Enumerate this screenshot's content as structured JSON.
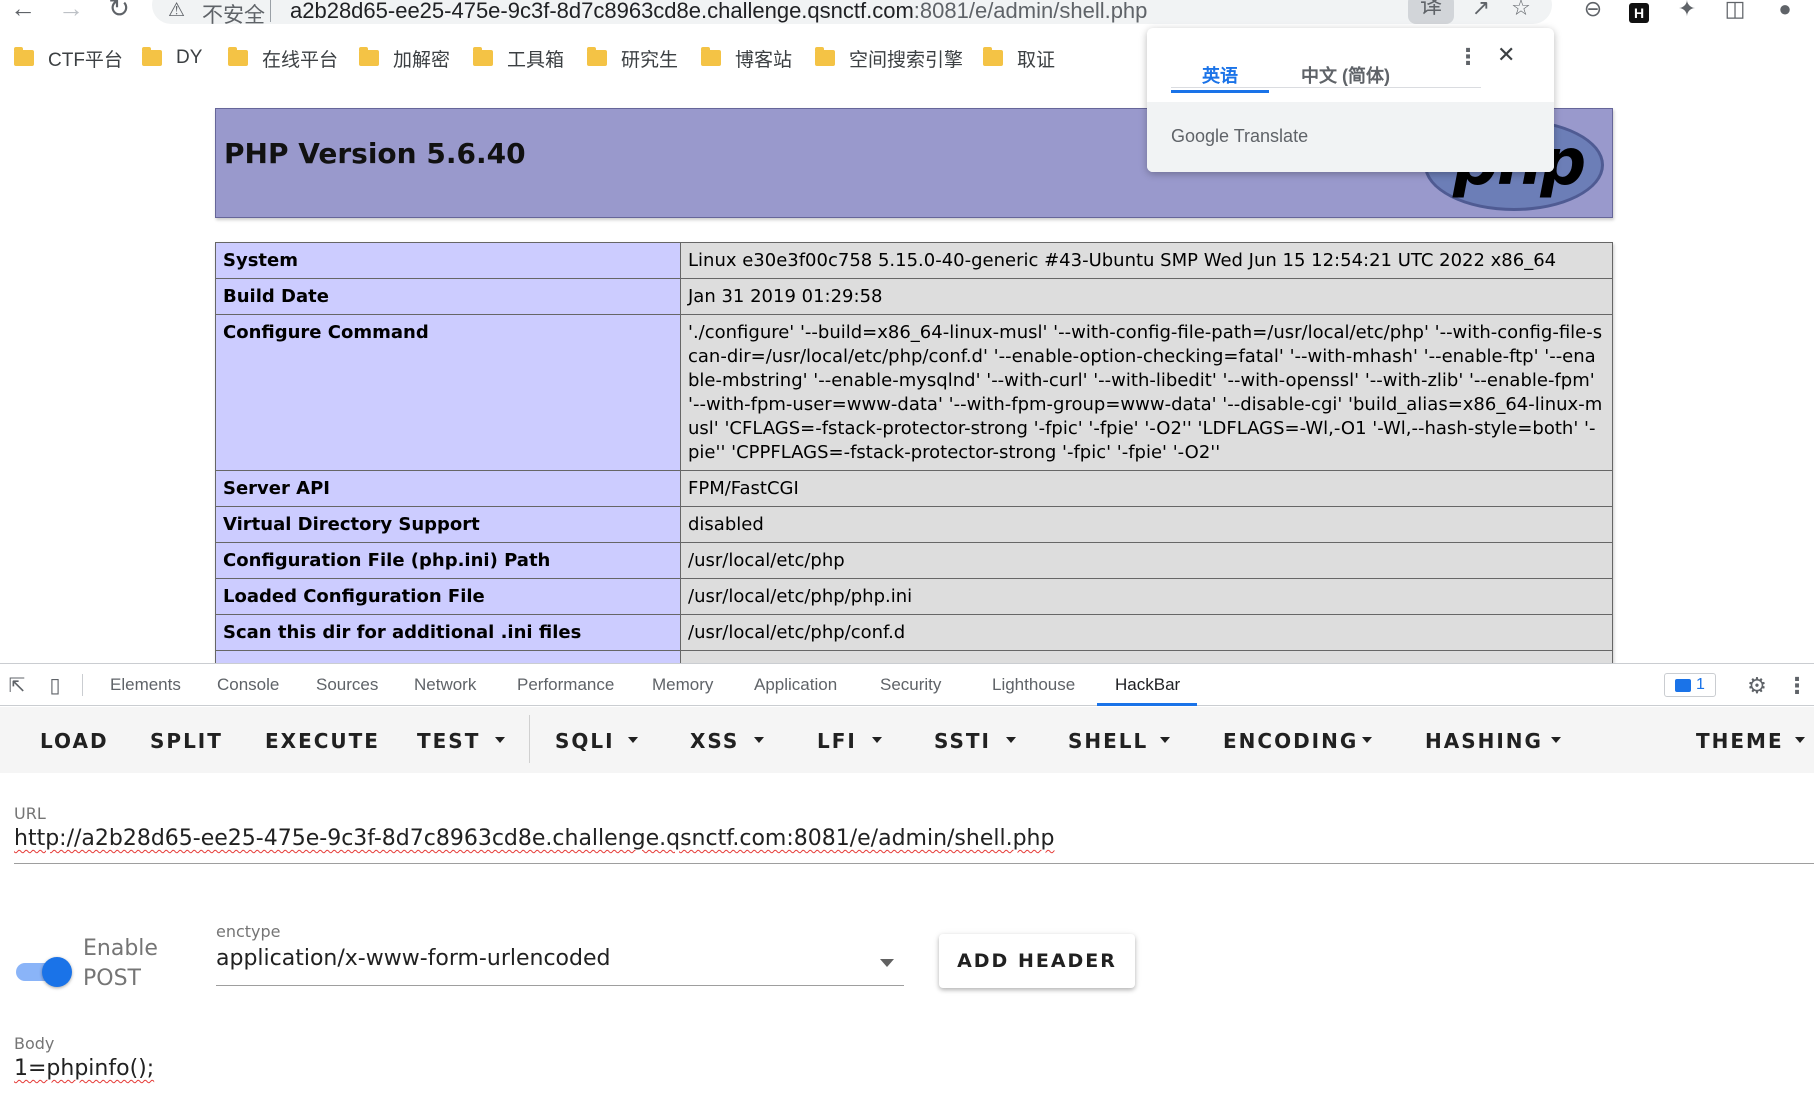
{
  "browser": {
    "address": {
      "security_label": "不安全",
      "host": "a2b28d65-ee25-475e-9c3f-8d7c8963cd8e.challenge.qsnctf.com",
      "rest": ":8081/e/admin/shell.php"
    },
    "bookmarks": [
      "CTF平台",
      "DY",
      "在线平台",
      "加解密",
      "工具箱",
      "研究生",
      "博客站",
      "空间搜索引擎",
      "取证"
    ],
    "icons": {
      "back": "back-arrow-icon",
      "forward": "forward-arrow-icon",
      "reload": "reload-icon",
      "translate": "translate-icon",
      "share": "share-icon",
      "star": "star-icon",
      "minus": "minus-circle-icon",
      "ext_h": "extension-h-icon",
      "puzzle": "puzzle-icon",
      "sidepanel": "side-panel-icon",
      "profile": "profile-icon"
    }
  },
  "translate_popup": {
    "tab_active": "英语",
    "tab_inactive": "中文 (简体)",
    "brand": "Google Translate"
  },
  "phpinfo": {
    "title": "PHP Version 5.6.40",
    "logo_text": "php",
    "rows": [
      {
        "key": "System",
        "value": "Linux e30e3f00c758 5.15.0-40-generic #43-Ubuntu SMP Wed Jun 15 12:54:21 UTC 2022 x86_64"
      },
      {
        "key": "Build Date",
        "value": "Jan 31 2019 01:29:58"
      },
      {
        "key": "Configure Command",
        "value": "'./configure' '--build=x86_64-linux-musl' '--with-config-file-path=/usr/local/etc/php' '--with-config-file-scan-dir=/usr/local/etc/php/conf.d' '--enable-option-checking=fatal' '--with-mhash' '--enable-ftp' '--enable-mbstring' '--enable-mysqlnd' '--with-curl' '--with-libedit' '--with-openssl' '--with-zlib' '--enable-fpm' '--with-fpm-user=www-data' '--with-fpm-group=www-data' '--disable-cgi' 'build_alias=x86_64-linux-musl' 'CFLAGS=-fstack-protector-strong '-fpic' '-fpie' '-O2'' 'LDFLAGS=-Wl,-O1 '-Wl,--hash-style=both' '-pie'' 'CPPFLAGS=-fstack-protector-strong '-fpic' '-fpie' '-O2''"
      },
      {
        "key": "Server API",
        "value": "FPM/FastCGI"
      },
      {
        "key": "Virtual Directory Support",
        "value": "disabled"
      },
      {
        "key": "Configuration File (php.ini) Path",
        "value": "/usr/local/etc/php"
      },
      {
        "key": "Loaded Configuration File",
        "value": "/usr/local/etc/php/php.ini"
      },
      {
        "key": "Scan this dir for additional .ini files",
        "value": "/usr/local/etc/php/conf.d"
      },
      {
        "key": "",
        "value": ""
      }
    ]
  },
  "devtools": {
    "tabs": [
      "Elements",
      "Console",
      "Sources",
      "Network",
      "Performance",
      "Memory",
      "Application",
      "Security",
      "Lighthouse",
      "HackBar"
    ],
    "active_tab": "HackBar",
    "issues_count": "1"
  },
  "hackbar": {
    "menu": {
      "load": "LOAD",
      "split": "SPLIT",
      "execute": "EXECUTE",
      "test": "TEST",
      "sqli": "SQLI",
      "xss": "XSS",
      "lfi": "LFI",
      "ssti": "SSTI",
      "shell": "SHELL",
      "encoding": "ENCODING",
      "hashing": "HASHING",
      "theme": "THEME"
    },
    "url_label": "URL",
    "url_value": "http://a2b28d65-ee25-475e-9c3f-8d7c8963cd8e.challenge.qsnctf.com:8081/e/admin/shell.php",
    "enable_post_line1": "Enable",
    "enable_post_line2": "POST",
    "enable_post_on": true,
    "enctype_label": "enctype",
    "enctype_value": "application/x-www-form-urlencoded",
    "add_header": "ADD HEADER",
    "body_label": "Body",
    "body_value": "1=phpinfo();"
  }
}
